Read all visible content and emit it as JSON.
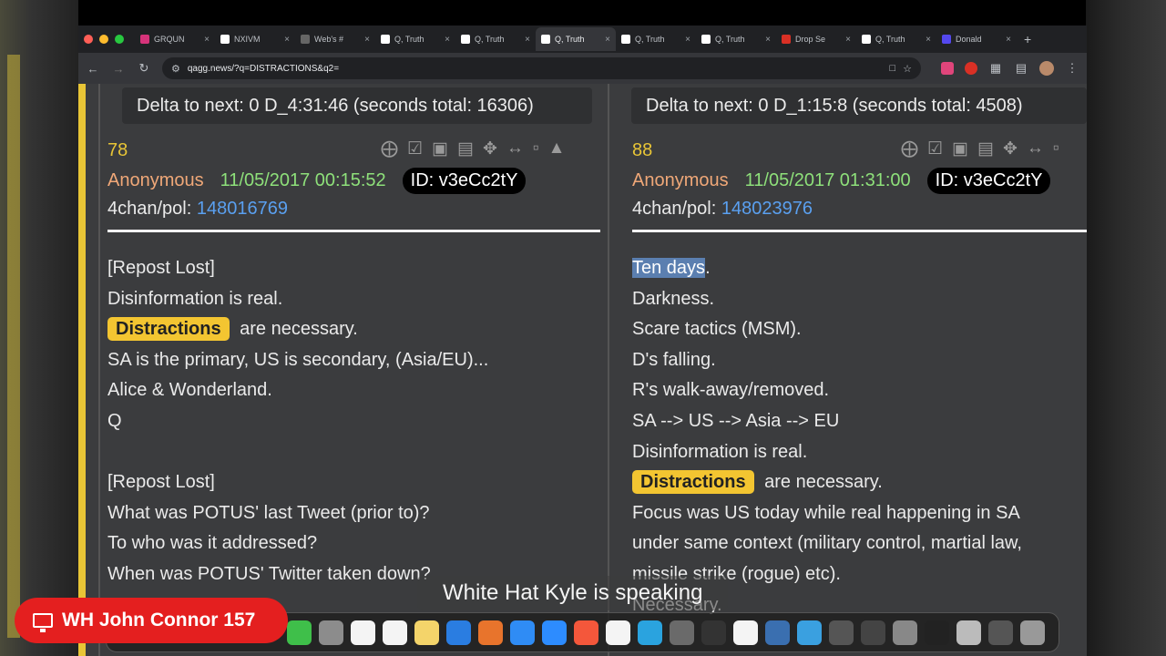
{
  "browser": {
    "tabs": [
      {
        "title": "GRQUN",
        "fav": "instagram-icon",
        "color": "#d6337a"
      },
      {
        "title": "NXIVM",
        "fav": "wikipedia-icon",
        "color": "#ffffff"
      },
      {
        "title": "Web's #",
        "fav": "web-icon",
        "color": "#666666"
      },
      {
        "title": "Q, Truth",
        "fav": "q-icon",
        "color": "#ffffff"
      },
      {
        "title": "Q, Truth",
        "fav": "q-icon",
        "color": "#ffffff"
      },
      {
        "title": "Q, Truth",
        "fav": "q-icon",
        "color": "#ffffff",
        "active": true
      },
      {
        "title": "Q, Truth",
        "fav": "q-icon",
        "color": "#ffffff"
      },
      {
        "title": "Q, Truth",
        "fav": "q-icon",
        "color": "#ffffff"
      },
      {
        "title": "Drop Se",
        "fav": "q-red-icon",
        "color": "#d93025"
      },
      {
        "title": "Q, Truth",
        "fav": "q-icon",
        "color": "#ffffff"
      },
      {
        "title": "Donald",
        "fav": "truth-social-icon",
        "color": "#5448ee"
      }
    ],
    "url": "qagg.news/?q=DISTRACTIONS&q2="
  },
  "left_post": {
    "delta": "Delta to next: 0 D_4:31:46  (seconds total: 16306)",
    "number": "78",
    "author": "Anonymous",
    "datetime": "11/05/2017 00:15:52",
    "id": "ID: v3eCc2tY",
    "board": "4chan/pol:",
    "thread": "148016769",
    "lines": [
      "[Repost Lost]",
      "Disinformation is real.",
      "Distractions| are necessary.",
      "SA is the primary, US is secondary, (Asia/EU)...",
      "Alice & Wonderland.",
      "Q",
      "",
      "[Repost Lost]",
      "What was POTUS' last Tweet (prior to)?",
      "To who was it addressed?",
      "When was POTUS' Twitter taken down?",
      "                                                   ?"
    ]
  },
  "right_post": {
    "delta": "Delta to next: 0 D_1:15:8  (seconds total: 4508)",
    "number": "88",
    "author": "Anonymous",
    "datetime": "11/05/2017 01:31:00",
    "id": "ID: v3eCc2tY",
    "board": "4chan/pol:",
    "thread": "148023976",
    "selected_first": "Ten days",
    "lines": [
      "Ten days.",
      "Darkness.",
      "Scare tactics (MSM).",
      "D's falling.",
      "R's walk-away/removed.",
      "SA --> US --> Asia --> EU",
      "Disinformation is real.",
      "Distractions| are necessary.",
      "Focus was US today while real happening in SA",
      "under same context (military control, martial law,",
      "missile strike (rogue) etc).",
      "Necessary."
    ]
  },
  "highlight_word": "Distractions",
  "caption": "White Hat Kyle is speaking",
  "badge": "WH John Connor 157",
  "colors": {
    "accent_yellow": "#f3c531",
    "badge_red": "#e41f1f",
    "link_blue": "#5aa0f0",
    "date_green": "#8ee07a",
    "author_orange": "#f0a878"
  }
}
